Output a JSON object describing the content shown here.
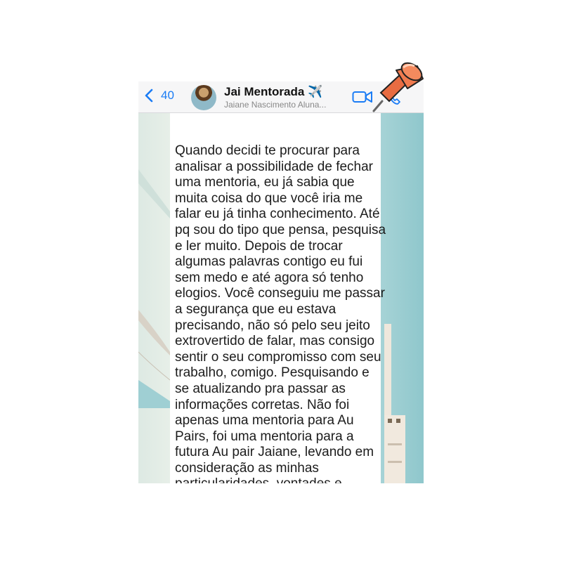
{
  "header": {
    "back_count": "40",
    "contact_name": "Jai  Mentorada ✈️",
    "contact_subtitle": "Jaiane Nascimento Aluna..."
  },
  "icons": {
    "back": "chevron-left-icon",
    "video": "video-camera-icon",
    "call": "phone-icon",
    "pin": "push-pin-icon"
  },
  "colors": {
    "accent": "#1a7cf5",
    "pin": "#f07a4e"
  },
  "message": {
    "text": "Quando decidi te procurar para analisar a possibilidade de fechar uma mentoria, eu já sabia que muita coisa do que você iria me falar eu já tinha conhecimento. Até pq sou do tipo que pensa, pesquisa e ler muito. Depois de trocar algumas palavras contigo eu fui sem medo e até agora só tenho elogios. Você conseguiu me passar a segurança que eu estava precisando, não só pelo seu jeito extrovertido de falar, mas consigo sentir o seu compromisso com seu trabalho, comigo. Pesquisando e se atualizando pra passar as informações corretas. Não foi apenas uma mentoria para Au Pairs, foi uma mentoria para a futura Au pair Jaiane, levando em consideração as minhas particularidades, vontades e medos. Obrigada!"
  }
}
